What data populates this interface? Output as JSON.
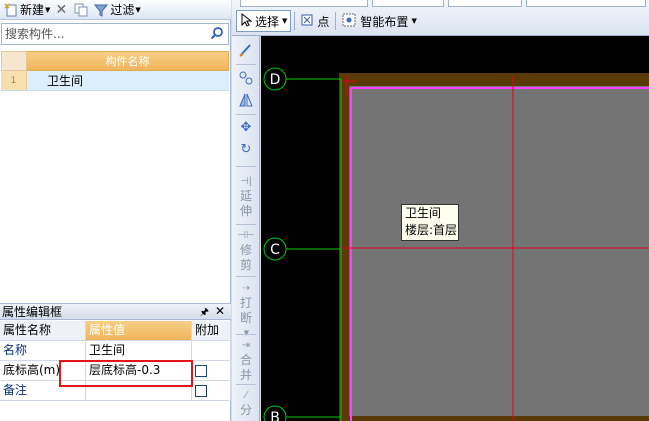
{
  "left_toolbar": {
    "new_label": "新建",
    "filter_label": "过滤"
  },
  "search": {
    "placeholder": "搜索构件..."
  },
  "component_table": {
    "header": "构件名称",
    "rows": [
      {
        "index": "1",
        "name": "卫生间"
      }
    ]
  },
  "property_panel": {
    "title": "属性编辑框",
    "columns": {
      "name": "属性名称",
      "value": "属性值",
      "extra": "附加"
    },
    "rows": [
      {
        "name": "名称",
        "value": "卫生间",
        "has_checkbox": false
      },
      {
        "name": "底标高(m)",
        "value": "层底标高-0.3",
        "has_checkbox": true
      },
      {
        "name": "备注",
        "value": "",
        "has_checkbox": true
      }
    ]
  },
  "top_toolbar": {
    "select_label": "选择",
    "point_label": "点",
    "smart_layout_label": "智能布置"
  },
  "vertical_toolbar": {
    "extend_label": [
      "延",
      "伸"
    ],
    "trim_label": [
      "修",
      "剪"
    ],
    "break_label": [
      "打",
      "断"
    ],
    "merge_label": [
      "合",
      "并"
    ],
    "split_label": [
      "分"
    ]
  },
  "canvas": {
    "axes": [
      "D",
      "C",
      "B"
    ],
    "tooltip_line1": "卫生间",
    "tooltip_line2": "楼层:首层"
  },
  "colors": {
    "axis_green": "#00c800",
    "wall_brown": "#5a3a06",
    "floor_gray": "#747474",
    "magenta": "#ff40ff",
    "grid_red": "#e8001c",
    "highlight_red": "#e0161b"
  }
}
